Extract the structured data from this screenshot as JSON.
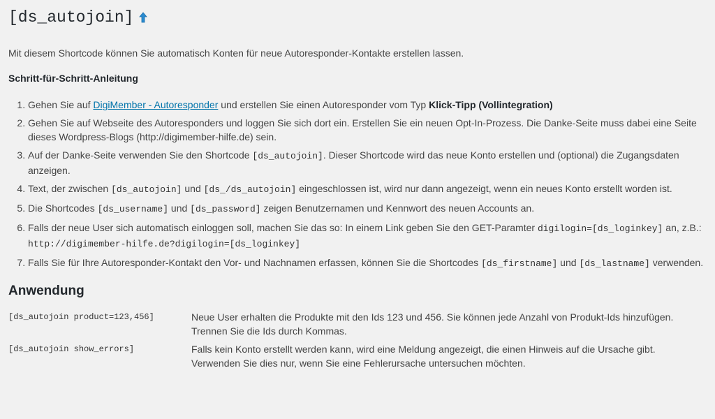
{
  "title": "[ds_autojoin]",
  "intro": "Mit diesem Shortcode können Sie automatisch Konten für neue Autoresponder-Kontakte erstellen lassen.",
  "subheading": "Schritt-für-Schritt-Anleitung",
  "steps": {
    "s1": {
      "a": "Gehen Sie auf ",
      "link": "DigiMember - Autoresponder",
      "b": " und erstellen Sie einen Autoresponder vom Typ ",
      "strong": "Klick-Tipp (Vollintegration)"
    },
    "s2": {
      "text": "Gehen Sie auf Webseite des Autoresponders und loggen Sie sich dort ein. Erstellen Sie ein neuen Opt-In-Prozess. Die Danke-Seite muss dabei eine Seite dieses Wordpress-Blogs (http://digimember-hilfe.de) sein."
    },
    "s3": {
      "a": "Auf der Danke-Seite verwenden Sie den Shortcode ",
      "code": "[ds_autojoin]",
      "b": ". Dieser Shortcode wird das neue Konto erstellen und (optional) die Zugangsdaten anzeigen."
    },
    "s4": {
      "a": "Text, der zwischen ",
      "code1": "[ds_autojoin]",
      "b": " und ",
      "code2": "[ds_/ds_autojoin]",
      "c": " eingeschlossen ist, wird nur dann angezeigt, wenn ein neues Konto erstellt worden ist."
    },
    "s5": {
      "a": "Die Shortcodes ",
      "code1": "[ds_username]",
      "b": " und ",
      "code2": "[ds_password]",
      "c": " zeigen Benutzernamen und Kennwort des neuen Accounts an."
    },
    "s6": {
      "a": "Falls der neue User sich automatisch einloggen soll, machen Sie das so: In einem Link geben Sie den GET-Paramter ",
      "code1": "digilogin=[ds_loginkey]",
      "b": " an, z.B.: ",
      "code2": "http://digimember-hilfe.de?digilogin=[ds_loginkey]"
    },
    "s7": {
      "a": "Falls Sie für Ihre Autoresponder-Kontakt den Vor- und Nachnamen erfassen, können Sie die Shortcodes ",
      "code1": "[ds_firstname]",
      "b": " und ",
      "code2": "[ds_lastname]",
      "c": " verwenden."
    }
  },
  "usage_heading": "Anwendung",
  "usage": [
    {
      "code": "[ds_autojoin product=123,456]",
      "desc": "Neue User erhalten die Produkte mit den Ids 123 und 456. Sie können jede Anzahl von Produkt-Ids hinzufügen. Trennen Sie die Ids durch Kommas."
    },
    {
      "code": "[ds_autojoin show_errors]",
      "desc": "Falls kein Konto erstellt werden kann, wird eine Meldung angezeigt, die einen Hinweis auf die Ursache gibt. Verwenden Sie dies nur, wenn Sie eine Fehlerursache untersuchen möchten."
    }
  ],
  "icons": {
    "title_arrow": "arrow-up-icon"
  },
  "colors": {
    "link": "#0073aa",
    "arrow": "#2a8bd0"
  }
}
